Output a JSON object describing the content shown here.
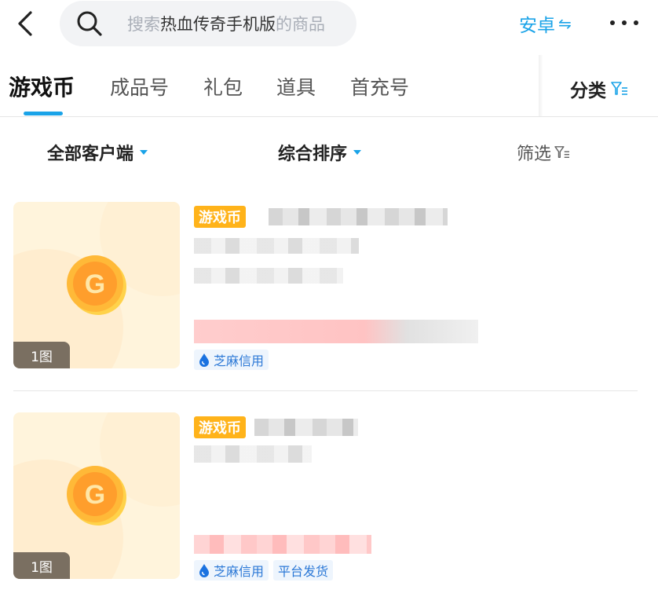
{
  "header": {
    "search": {
      "placeholder_prefix": "搜索",
      "keyword": "热血传奇手机版",
      "placeholder_suffix": "的商品"
    },
    "platform_label": "安卓",
    "platform_switch_glyph": "⇋"
  },
  "tabs": [
    {
      "label": "游戏币",
      "active": true
    },
    {
      "label": "成品号",
      "active": false
    },
    {
      "label": "礼包",
      "active": false
    },
    {
      "label": "道具",
      "active": false
    },
    {
      "label": "首充号",
      "active": false
    }
  ],
  "category_label": "分类",
  "filters": {
    "client": "全部客户端",
    "sort": "综合排序",
    "screen": "筛选"
  },
  "listings": [
    {
      "image_count": "1图",
      "type_tag": "游戏币",
      "tags": [
        "芝麻信用"
      ]
    },
    {
      "image_count": "1图",
      "type_tag": "游戏币",
      "tags": [
        "芝麻信用",
        "平台发货"
      ]
    }
  ],
  "colors": {
    "accent": "#1aa3e8",
    "tag_yellow": "#ffb31a",
    "credit_blue": "#2b78d6"
  },
  "icons": [
    "back-arrow-icon",
    "search-icon",
    "swap-icon",
    "more-icon",
    "filter-icon",
    "caret-down-icon",
    "coin-icon",
    "water-drop-icon"
  ]
}
